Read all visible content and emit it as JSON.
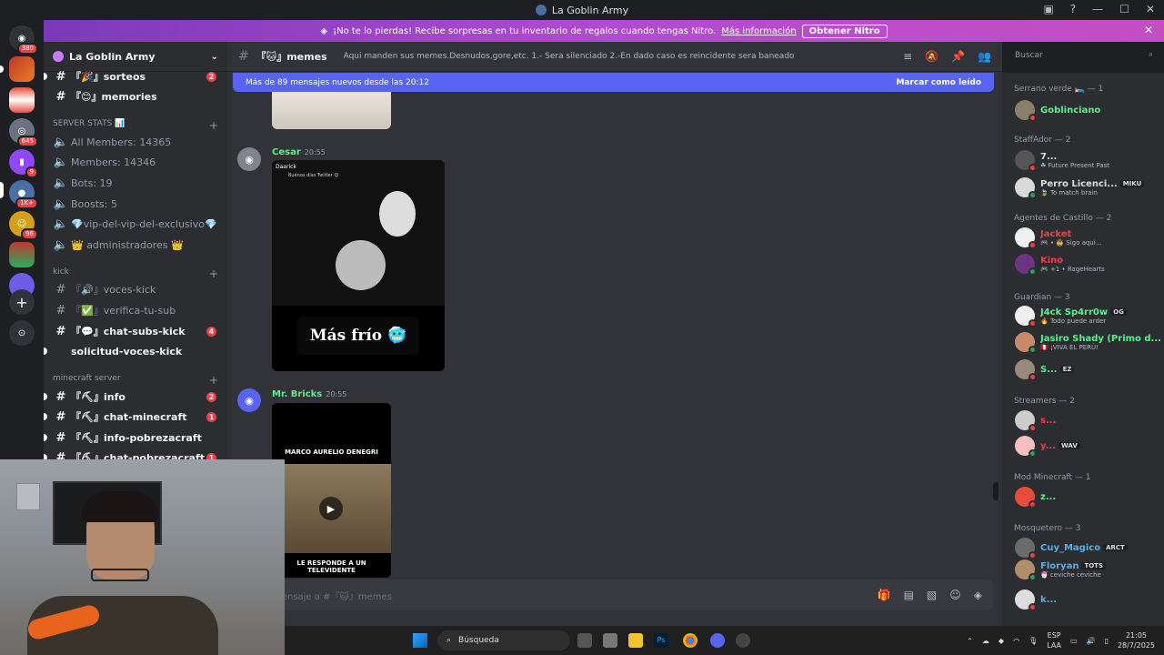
{
  "window": {
    "title": "La Goblin Army"
  },
  "banner": {
    "text": "¡No te lo pierdas! Recibe sorpresas en tu inventario de regalos cuando tengas Nitro.",
    "link": "Más información",
    "button": "Obtener Nitro"
  },
  "guilds": [
    {
      "badge": "380"
    },
    {
      "badge": ""
    },
    {
      "badge": ""
    },
    {
      "badge": "645"
    },
    {
      "badge": "9"
    },
    {
      "badge": "1K+"
    },
    {
      "badge": "96"
    },
    {
      "badge": ""
    },
    {
      "badge": ""
    }
  ],
  "server": {
    "name": "La Goblin Army"
  },
  "channels": {
    "c1": {
      "label": "『🎉』sorteos",
      "badge": "2"
    },
    "c2": {
      "label": "『😊』memories"
    },
    "stats_cat": "SERVER STATS 📊",
    "s1": "All Members: 14365",
    "s2": "Members: 14346",
    "s3": "Bots: 19",
    "s4": "Boosts: 5",
    "s5": "💎vip-del-vip-del-exclusivo💎",
    "s6": "👑 administradores 👑",
    "kick_cat": "kick",
    "k1": "『🔊』voces-kick",
    "k2": "『✅』verifica-tu-sub",
    "k3": {
      "label": "『💬』chat-subs-kick",
      "badge": "4"
    },
    "k4": "solicitud-voces-kick",
    "mc_cat": "minecraft server",
    "m1": {
      "label": "『⛏』info",
      "badge": "2"
    },
    "m2": {
      "label": "『⛏』chat-minecraft",
      "badge": "1"
    },
    "m3": "『⛏』info-pobrezacraft",
    "m4": {
      "label": "『⛏』chat-pobrezacraft",
      "badge": "1"
    }
  },
  "header": {
    "channel": "『🐱』memes",
    "topic": "Aqui manden sus memes.Desnudos,gore,etc. 1.- Sera silenciado 2.-En dado caso es reincidente sera baneado"
  },
  "newbar": {
    "text": "Más de 89 mensajes nuevos desde las 20:12",
    "mark": "Marcar como leído"
  },
  "messages": [
    {
      "author": "Cesar",
      "time": "20:55",
      "embed_author": "Daarick",
      "embed_text": "Buenos días Twitter 😊",
      "caption": "Más frío 🥶"
    },
    {
      "author": "Mr. Bricks",
      "time": "20:55",
      "video_top": "MARCO AURELIO DENEGRI",
      "video_bottom": "LE RESPONDE A UN TELEVIDENTE"
    }
  ],
  "composer": {
    "placeholder": "viar mensaje a #『🐱』memes"
  },
  "search": {
    "placeholder": "Buscar"
  },
  "member_groups": [
    {
      "title": "Serrano verde 🛌 — 1",
      "members": [
        {
          "name": "Goblinciano",
          "sub": "",
          "tag": "",
          "color": "#57f287"
        }
      ]
    },
    {
      "title": "StaffAdor — 2",
      "members": [
        {
          "name": "7...",
          "sub": "☘ Future Present Past",
          "tag": "",
          "color": "#dbdee1"
        },
        {
          "name": "Perro Licenci...",
          "sub": "🍃 To match brain",
          "tag": "MIKU",
          "color": "#dbdee1"
        }
      ]
    },
    {
      "title": "Agentes de Castillo — 2",
      "members": [
        {
          "name": "Jacket",
          "sub": "🎮 • 🤠 Sigo aqui...",
          "tag": "",
          "color": "#ed4245"
        },
        {
          "name": "Kino",
          "sub": "🎮 +1 • RageHearts",
          "tag": "",
          "color": "#ed4245"
        }
      ]
    },
    {
      "title": "Guardian — 3",
      "members": [
        {
          "name": "J4ck Sp4rr0w",
          "sub": "🔥 Todo puede arder",
          "tag": "OG",
          "color": "#57f287"
        },
        {
          "name": "Jasiro Shady (Primo d...",
          "sub": "🇵🇪 ¡VIVA EL PERÚ!",
          "tag": "",
          "color": "#57f287"
        },
        {
          "name": "S...",
          "sub": "",
          "tag": "EZ",
          "color": "#57f287"
        }
      ]
    },
    {
      "title": "Streamers — 2",
      "members": [
        {
          "name": "s...",
          "sub": "",
          "tag": "",
          "color": "#ed4245"
        },
        {
          "name": "y...",
          "sub": "",
          "tag": "WAV",
          "color": "#ed4245"
        }
      ]
    },
    {
      "title": "Mod Minecraft — 1",
      "members": [
        {
          "name": "z...",
          "sub": "",
          "tag": "",
          "color": "#57f287"
        }
      ]
    },
    {
      "title": "Mosquetero — 3",
      "members": [
        {
          "name": "Cuy_Magico",
          "sub": "",
          "tag": "ARCT",
          "color": "#5dade2"
        },
        {
          "name": "Floryan",
          "sub": "🍧 ceviche ceviche",
          "tag": "TOTS",
          "color": "#5dade2"
        },
        {
          "name": "k...",
          "sub": "",
          "tag": "",
          "color": "#5dade2"
        }
      ]
    }
  ],
  "taskbar": {
    "search": "Búsqueda",
    "lang1": "ESP",
    "lang2": "LAA",
    "time": "21:05",
    "date": "28/7/2025"
  }
}
